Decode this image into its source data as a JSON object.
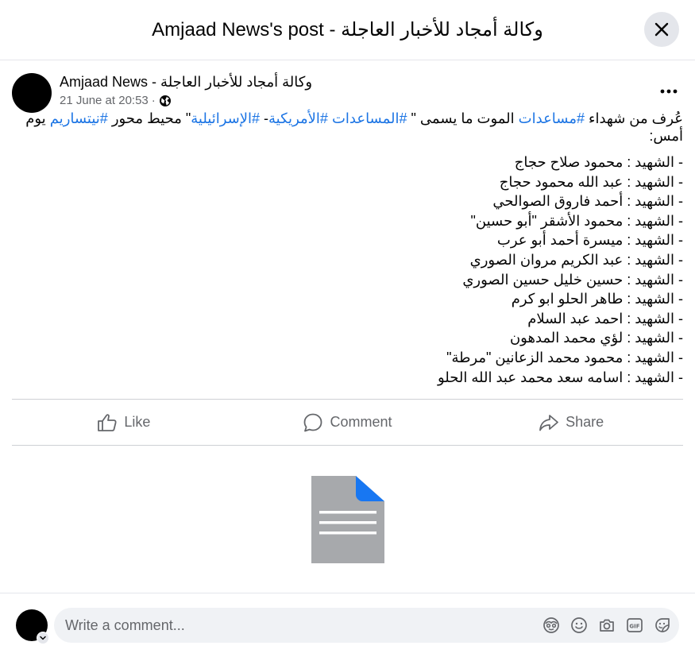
{
  "header": {
    "title": "وكالة أمجاد للأخبار العاجلة - Amjaad News's post"
  },
  "post": {
    "author": "وكالة أمجاد للأخبار العاجلة - Amjaad News",
    "timestamp": "21 June at 20:53",
    "separator": "·",
    "privacy_icon": "globe-icon",
    "intro_parts": [
      "عُرف من شهداء ",
      "#مساعدات",
      " الموت ما يسمى \" ",
      "#المساعدات",
      " ",
      "#الأمريكية",
      "- ",
      "#الإسرائيلية",
      "\" محيط محور ",
      "#نيتساريم",
      " يوم أمس:"
    ],
    "martyrs": [
      "- الشهيد : محمود صلاح حجاج",
      "- الشهيد : عبد الله محمود حجاج",
      "- الشهيد : أحمد فاروق الصوالحي",
      "- الشهيد : محمود الأشقر  \"أبو حسين\"",
      "- الشهيد : ميسرة أحمد أبو عرب",
      "- الشهيد : عبد الكريم مروان الصوري",
      "- الشهيد : حسين خليل حسين الصوري",
      "- الشهيد : طاهر الحلو ابو كرم",
      "- الشهيد : احمد عبد السلام",
      "- الشهيد : لؤي محمد المدهون",
      "- الشهيد : محمود محمد الزعانين \"مرطة\"",
      "- الشهيد : اسامه سعد محمد عبد الله الحلو"
    ]
  },
  "actions": {
    "like": "Like",
    "comment": "Comment",
    "share": "Share"
  },
  "composer": {
    "placeholder": "Write a comment...",
    "icons": [
      "avatar-sticker-icon",
      "emoji-icon",
      "camera-icon",
      "gif-icon",
      "sticker-icon"
    ]
  },
  "colors": {
    "hashtag": "#1b74e4",
    "secondary_text": "#65676b",
    "divider": "#ced0d4",
    "doc_grey": "#a7a9ac",
    "doc_fold": "#1877f2"
  }
}
